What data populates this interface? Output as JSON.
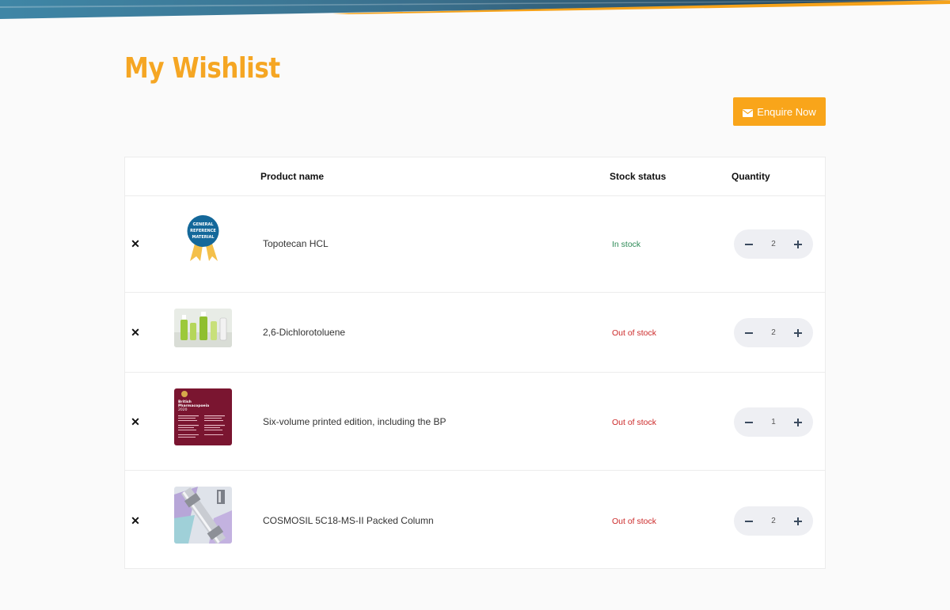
{
  "page": {
    "title": "My Wishlist"
  },
  "actions": {
    "enquire_label": "Enquire Now"
  },
  "table": {
    "headers": {
      "product": "Product name",
      "stock": "Stock status",
      "quantity": "Quantity"
    },
    "rows": [
      {
        "name": "Topotecan HCL",
        "stock": "In stock",
        "qty": "2",
        "thumb": "general-reference-material-badge",
        "badge_text": [
          "GENERAL",
          "REFERENCE",
          "MATERIAL"
        ]
      },
      {
        "name": "2,6-Dichlorotoluene",
        "stock": "Out of stock",
        "qty": "2",
        "thumb": "lab-bottles-photo"
      },
      {
        "name": "Six-volume printed edition, including the BP",
        "stock": "Out of stock",
        "qty": "1",
        "thumb": "british-pharmacopoeia-cover",
        "cover_text": [
          "British",
          "Pharmacopoeia",
          "2020"
        ]
      },
      {
        "name": "COSMOSIL 5C18-MS-II Packed Column",
        "stock": "Out of stock",
        "qty": "2",
        "thumb": "hplc-column-photo"
      }
    ]
  },
  "colors": {
    "accent": "#f5a623",
    "button": "#f9a51a",
    "in_stock": "#2e8b57",
    "out_of_stock": "#cc2a2a"
  }
}
